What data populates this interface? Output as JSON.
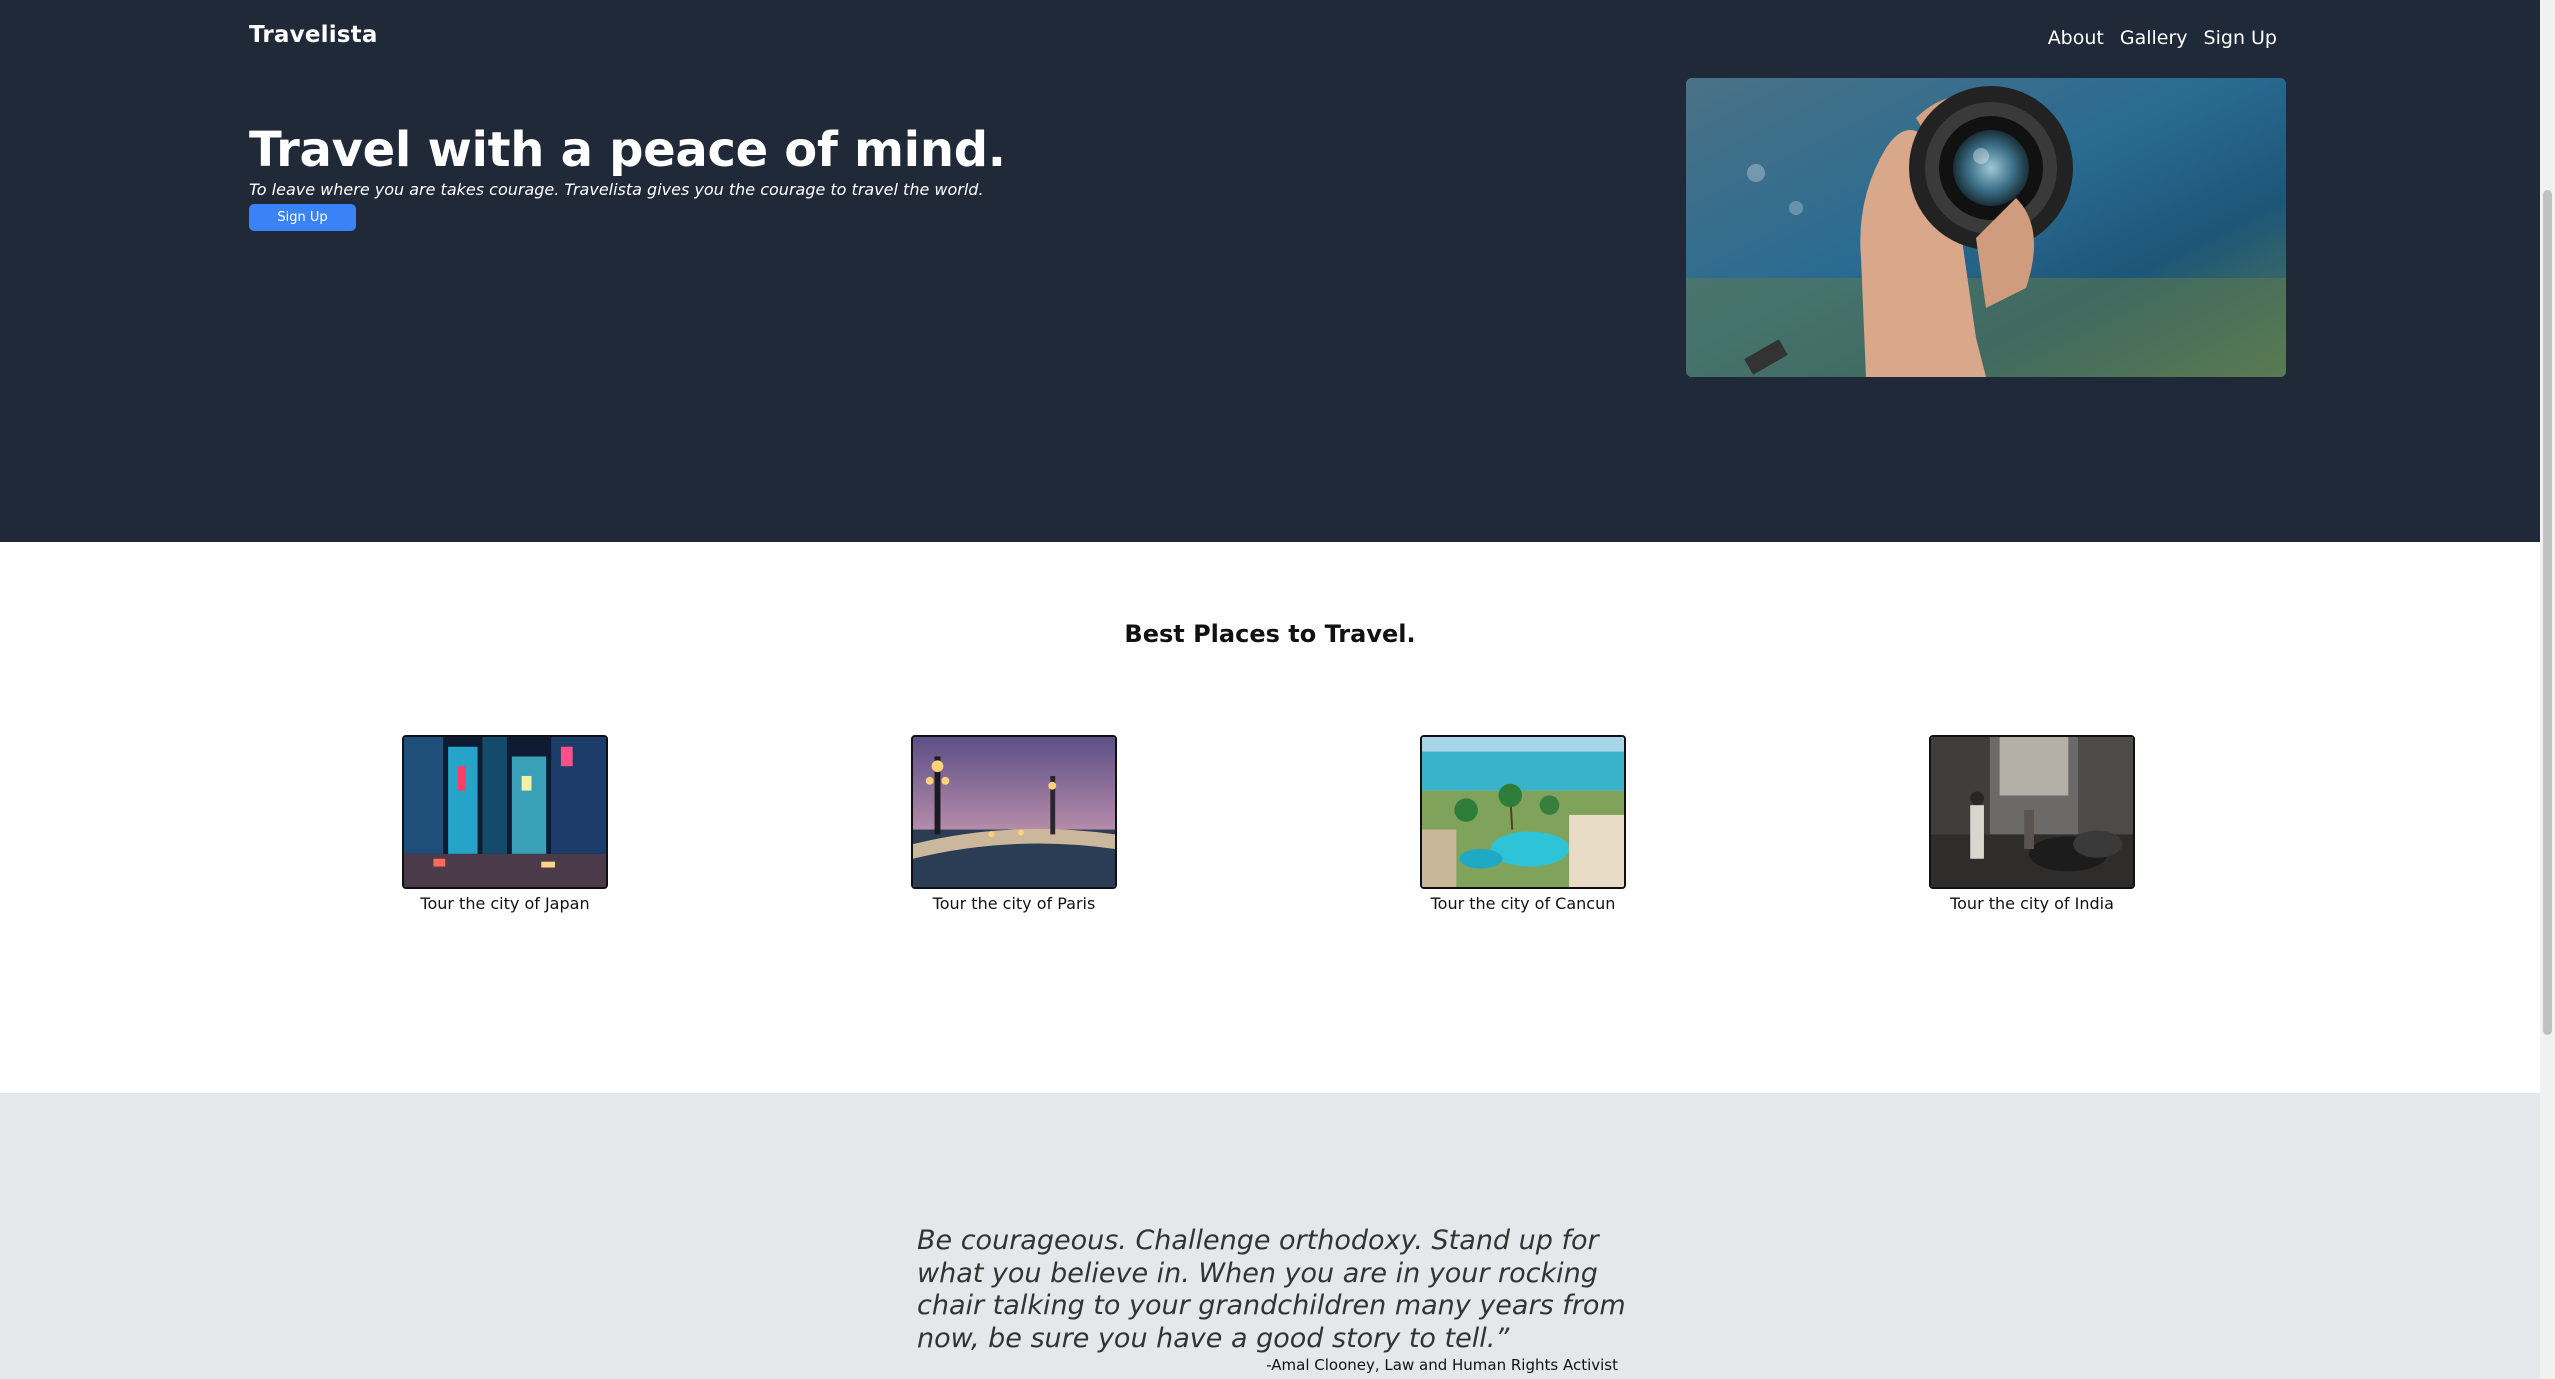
{
  "header": {
    "brand": "Travelista",
    "nav": [
      "About",
      "Gallery",
      "Sign Up"
    ]
  },
  "hero": {
    "title": "Travel with a peace of mind.",
    "subtitle": "To leave where you are takes courage. Travelista gives you the courage to travel the world.",
    "cta_label": "Sign Up"
  },
  "places": {
    "title": "Best Places to Travel.",
    "items": [
      {
        "label": "Tour the city of Japan"
      },
      {
        "label": "Tour the city of Paris"
      },
      {
        "label": "Tour the city of Cancun"
      },
      {
        "label": "Tour the city of India"
      }
    ]
  },
  "quote": {
    "text": "Be courageous. Challenge orthodoxy. Stand up for what you believe in. When you are in your rocking chair talking to your grandchildren many years from now, be sure you have a good story to tell.”",
    "author": "-Amal Clooney, Law and Human Rights Activist"
  },
  "colors": {
    "hero_bg": "#1f2937",
    "accent": "#3b82f6",
    "quote_bg": "#e5e7eb"
  }
}
